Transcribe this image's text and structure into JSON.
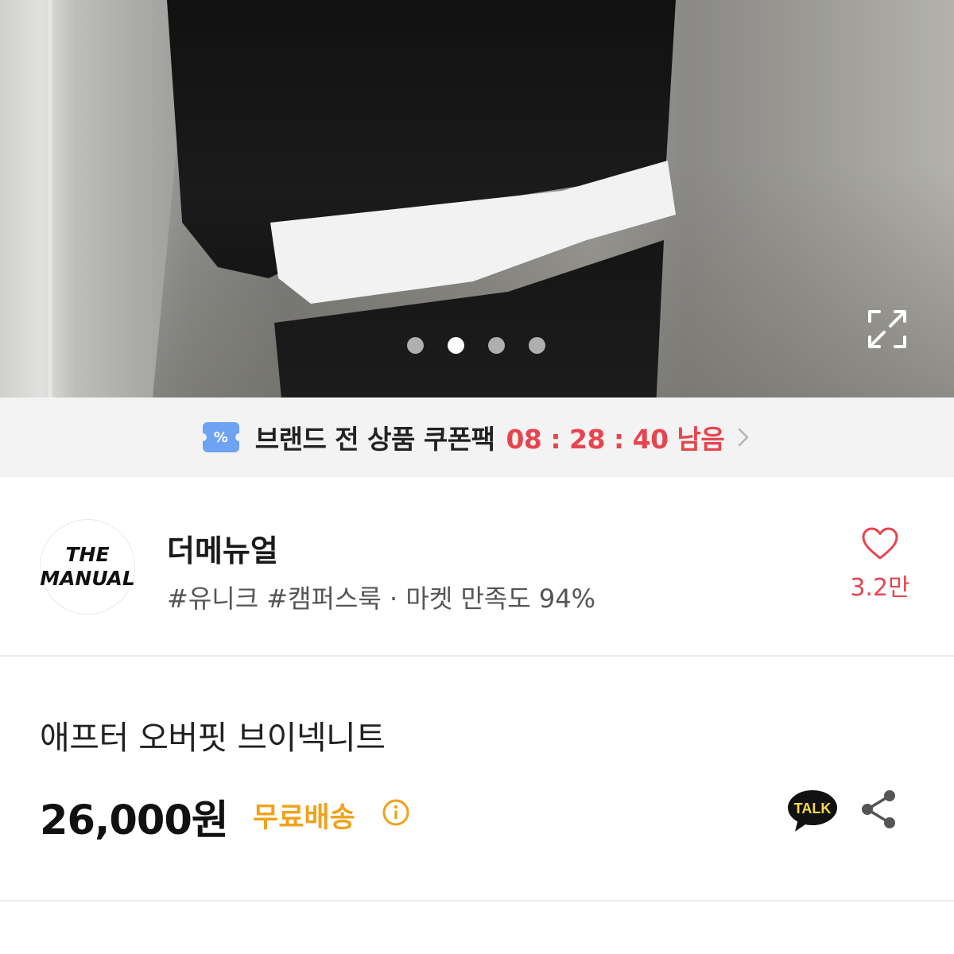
{
  "gallery": {
    "photo_icon": "product-photo",
    "slide_count": 4,
    "active_slide": 2,
    "expand_icon": "expand-icon"
  },
  "coupon": {
    "icon": "coupon-ticket-icon",
    "icon_symbol": "%",
    "text": "브랜드 전 상품 쿠폰팩",
    "timer": "08 : 28 : 40 남음",
    "chevron_icon": "chevron-right-icon",
    "icon_color": "#6ea2f2",
    "timer_color": "#e64550"
  },
  "brand": {
    "logo_line1": "THE",
    "logo_line2": "MANUAL",
    "name": "더메뉴얼",
    "tags": "#유니크 #캠퍼스룩 · 마켓 만족도 94%",
    "like_icon": "heart-icon",
    "like_count": "3.2만",
    "like_color": "#e64550"
  },
  "product": {
    "title": "애프터 오버핏 브이넥니트",
    "price": "26,000원",
    "shipping": "무료배송",
    "shipping_color": "#f0a21b",
    "info_icon": "info-icon",
    "talk_icon": "kakao-talk-icon",
    "talk_label": "TALK",
    "share_icon": "share-icon"
  }
}
